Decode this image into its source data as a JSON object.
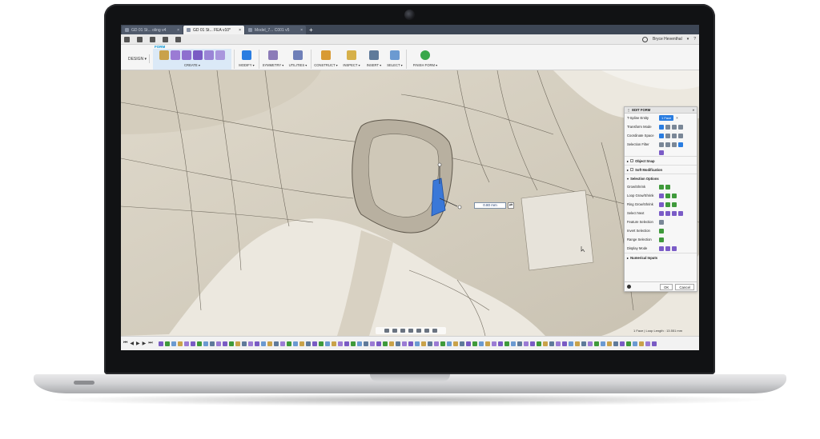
{
  "tabs": [
    {
      "label": "GD 01 St... oling v4",
      "active": false
    },
    {
      "label": "GD 01 St... FEA v10*",
      "active": true
    },
    {
      "label": "Model_7... C001 v5",
      "active": false
    }
  ],
  "tab_add": "+",
  "tab_close": "×",
  "user": {
    "name": "Bryce Heventhal",
    "caret": "▾",
    "help": "?"
  },
  "workspace": {
    "label": "DESIGN ▾"
  },
  "ribbon": {
    "active_tab": "FORM",
    "groups": [
      "CREATE ▾",
      "MODIFY ▾",
      "SYMMETRY ▾",
      "UTILITIES ▾",
      "CONSTRUCT ▾",
      "INSPECT ▾",
      "INSERT ▾",
      "SELECT ▾",
      "FINISH FORM ▾"
    ]
  },
  "viewport": {
    "dimension_value": "0.80 mm",
    "dimension_button": "⇄",
    "status": "1 Face | Loop Length : 13.551 mm"
  },
  "edit_form": {
    "title": "EDIT FORM",
    "tspline_entity_label": "T-Spline Entity",
    "tspline_entity_value": "1 Face",
    "rows": [
      "Transform Mode",
      "Coordinate Space",
      "Selection Filter"
    ],
    "object_snap": "Object Snap",
    "soft_modification": "Soft Modification",
    "selection_options": "Selection Options",
    "selection_rows": [
      "Grow/Shrink",
      "Loop Grow/Shrink",
      "Ring Grow/Shrink",
      "Select Next",
      "Feature Selection",
      "Invert Selection",
      "Range Selection",
      "Display Mode"
    ],
    "numerical_inputs": "Numerical Inputs",
    "ok": "OK",
    "cancel": "Cancel"
  },
  "timeline_controls": [
    "⏮",
    "◀",
    "▶",
    "▶",
    "⏭"
  ],
  "colors": {
    "accent": "#0696d7",
    "selection": "#2a7de1",
    "mesh": "#e6e1d7",
    "tabbar": "#3d4655"
  }
}
